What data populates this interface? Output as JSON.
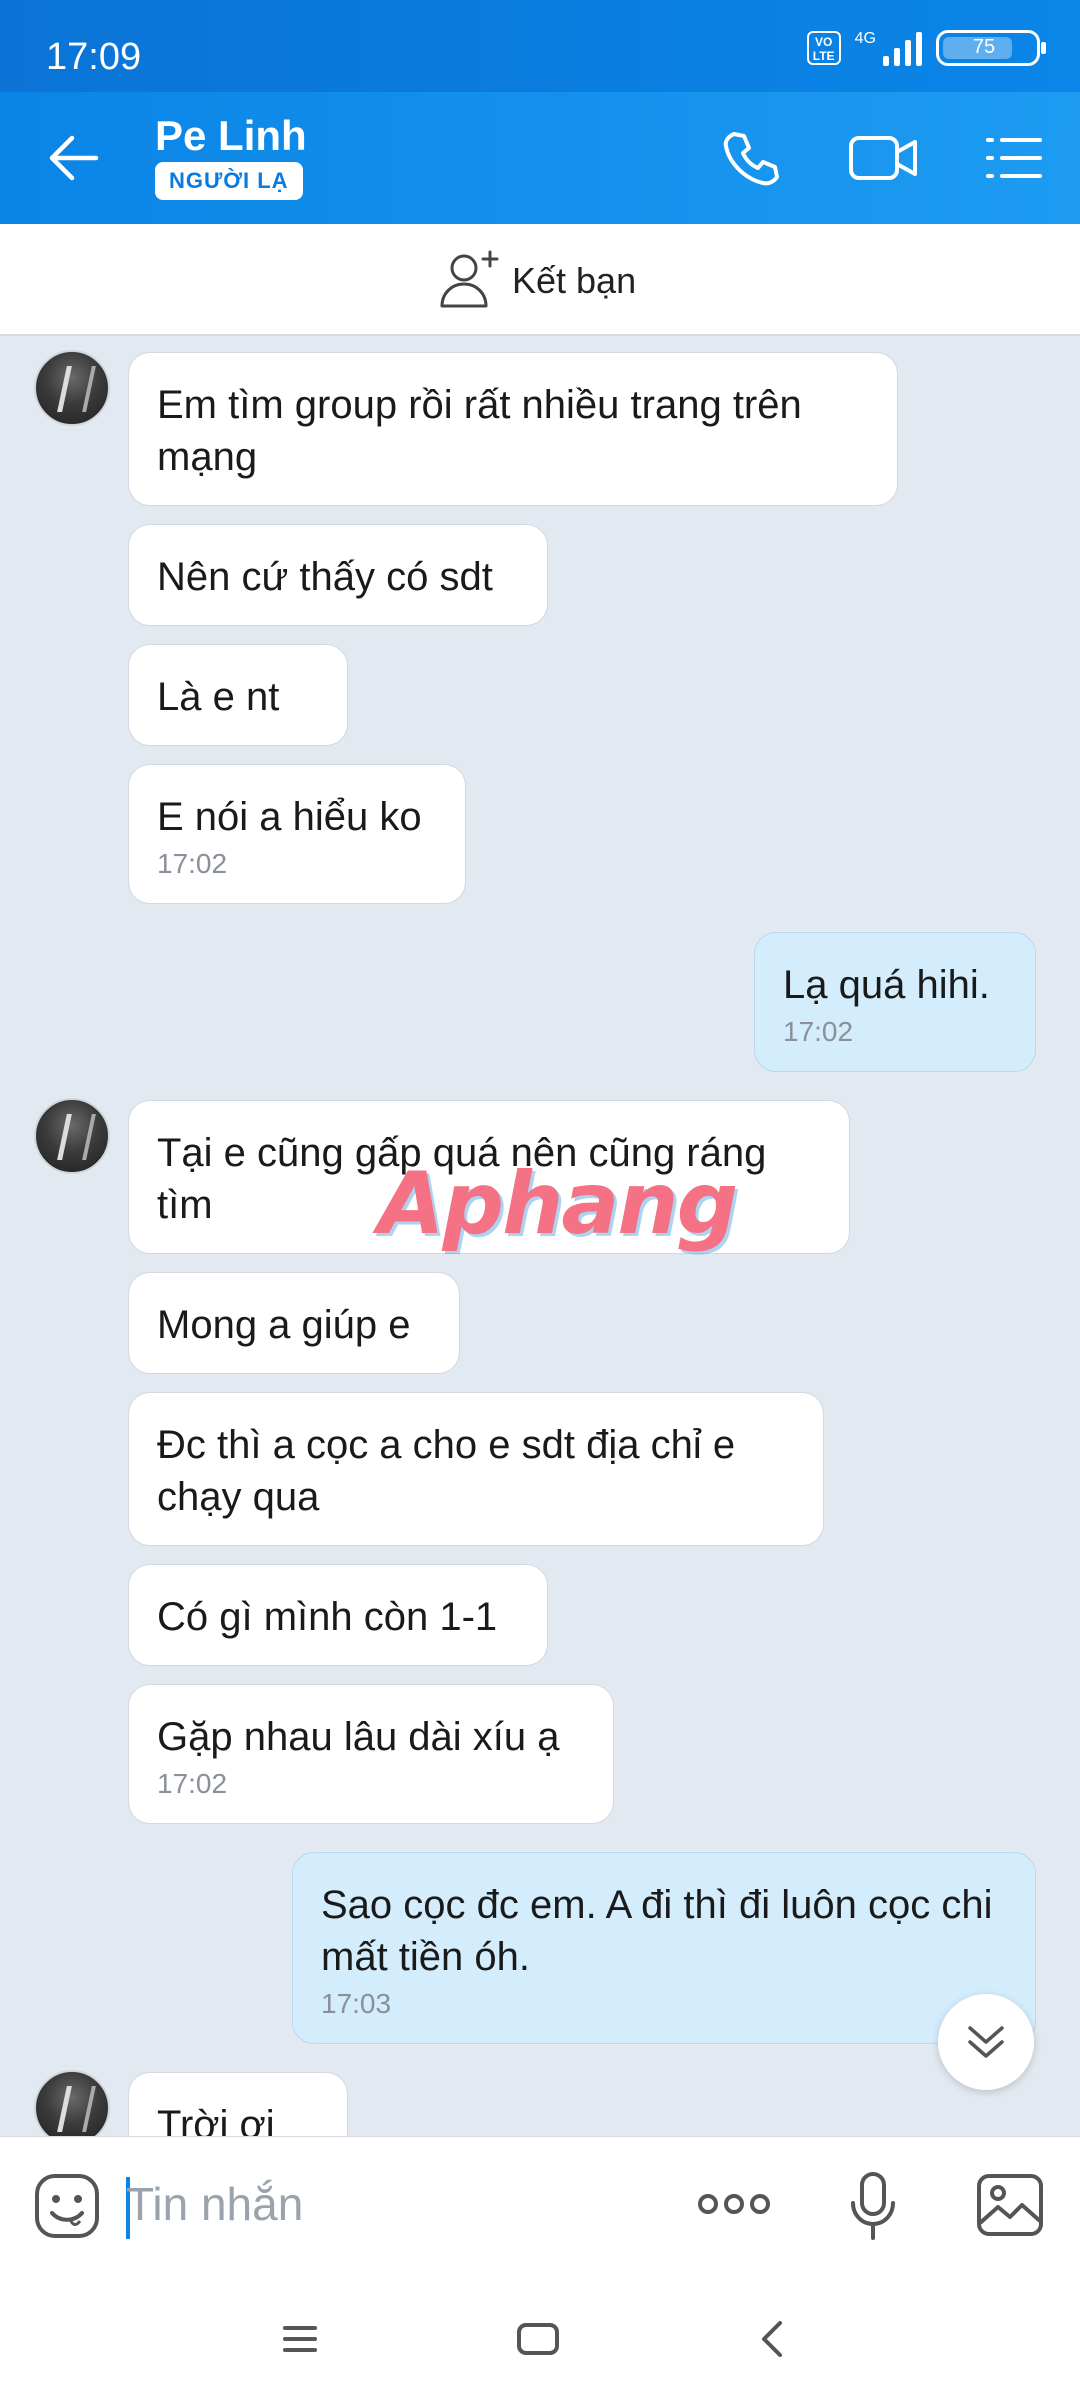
{
  "status": {
    "time": "17:09",
    "network": "4G",
    "volte": "VO LTE",
    "battery": "75"
  },
  "header": {
    "name": "Pe Linh",
    "badge": "NGƯỜI LẠ"
  },
  "friend_bar": {
    "label": "Kết bạn"
  },
  "messages": [
    {
      "text": "Em tìm group rồi rất nhiều trang trên mạng",
      "time": ""
    },
    {
      "text": "Nên cứ thấy có sdt",
      "time": ""
    },
    {
      "text": "Là e nt",
      "time": ""
    },
    {
      "text": "E nói a hiểu ko",
      "time": "17:02"
    },
    {
      "text": "Lạ quá hihi.",
      "time": "17:02"
    },
    {
      "text": "Tại e cũng gấp quá nên cũng ráng tìm",
      "time": ""
    },
    {
      "text": "Mong a giúp e",
      "time": ""
    },
    {
      "text": "Đc thì a cọc a cho e sdt địa chỉ e chạy qua",
      "time": ""
    },
    {
      "text": "Có gì mình còn 1-1",
      "time": ""
    },
    {
      "text": "Gặp nhau lâu dài xíu ạ",
      "time": "17:02"
    },
    {
      "text": "Sao cọc đc em. A đi thì đi luôn cọc chi mất tiền óh.",
      "time": "17:03"
    },
    {
      "text": "Trời ơi",
      "time": ""
    }
  ],
  "watermark": "Aphang",
  "input": {
    "placeholder": "Tin nhắn"
  },
  "icons": [
    "back-arrow-icon",
    "phone-icon",
    "video-call-icon",
    "menu-list-icon",
    "add-friend-icon",
    "emoji-icon",
    "more-icon",
    "microphone-icon",
    "image-icon",
    "scroll-down-icon",
    "nav-menu-icon",
    "nav-home-icon",
    "nav-back-icon"
  ]
}
